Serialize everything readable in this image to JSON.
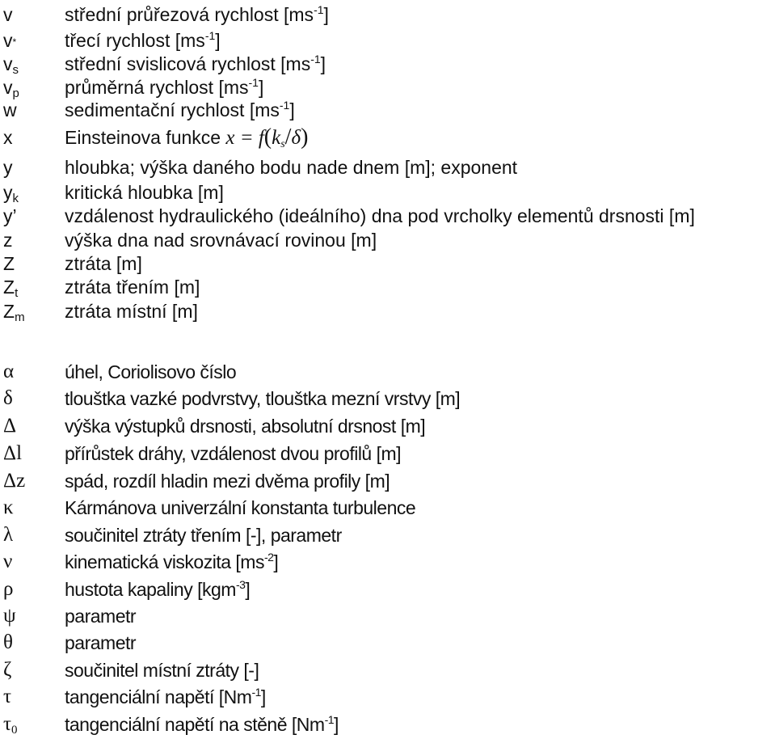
{
  "latin_symbols": [
    {
      "sym": "v",
      "sub": "",
      "desc": "střední průřezová rychlost [ms",
      "sup": "-1",
      "tail": "]"
    },
    {
      "sym": "v",
      "sub": "*",
      "desc": "třecí rychlost [ms",
      "sup": "-1",
      "tail": "]"
    },
    {
      "sym": "v",
      "sub": "s",
      "desc": "střední svislicová rychlost [ms",
      "sup": "-1",
      "tail": "]"
    },
    {
      "sym": "v",
      "sub": "p",
      "desc": "průměrná rychlost [ms",
      "sup": "-1",
      "tail": "]"
    },
    {
      "sym": "w",
      "sub": "",
      "desc": "sedimentační rychlost [ms",
      "sup": "-1",
      "tail": "]"
    },
    {
      "sym": "x",
      "sub": "",
      "desc": "Einsteinova funkce",
      "sup": "",
      "tail": ""
    },
    {
      "sym": "y",
      "sub": "",
      "desc": "hloubka; výška daného bodu nade dnem [m]; exponent",
      "sup": "",
      "tail": ""
    },
    {
      "sym": "y",
      "sub": "k",
      "desc": "kritická hloubka [m]",
      "sup": "",
      "tail": ""
    },
    {
      "sym": "y’",
      "sub": "",
      "desc": "vzdálenost hydraulického (ideálního) dna pod vrcholky elementů drsnosti [m]",
      "sup": "",
      "tail": ""
    },
    {
      "sym": "z",
      "sub": "",
      "desc": "výška dna nad srovnávací rovinou [m]",
      "sup": "",
      "tail": ""
    },
    {
      "sym": "Z",
      "sub": "",
      "desc": "ztráta [m]",
      "sup": "",
      "tail": ""
    },
    {
      "sym": "Z",
      "sub": "t",
      "desc": "ztráta třením [m]",
      "sup": "",
      "tail": ""
    },
    {
      "sym": "Z",
      "sub": "m",
      "desc": "ztráta místní [m]",
      "sup": "",
      "tail": ""
    }
  ],
  "einstein_formula": {
    "lhs": "x",
    "eq": " = ",
    "f": "f",
    "open": "(",
    "k": "k",
    "ksub": "s",
    "slash": "/",
    "delta": "δ",
    "close": ")"
  },
  "greek_symbols": [
    {
      "sym": "α",
      "sub": "",
      "desc": "úhel,  Coriolisovo číslo",
      "sup": "",
      "tail": ""
    },
    {
      "sym": "δ",
      "sub": "",
      "desc": "tlouštka vazké podvrstvy, tlouštka mezní vrstvy  [m]",
      "sup": "",
      "tail": ""
    },
    {
      "sym": "Δ",
      "sub": "",
      "desc": "výška výstupků drsnosti, absolutní drsnost  [m]",
      "sup": "",
      "tail": ""
    },
    {
      "sym": "Δl",
      "sub": "",
      "desc": "přírůstek dráhy, vzdálenost dvou profilů [m]",
      "sup": "",
      "tail": ""
    },
    {
      "sym": "Δz",
      "sub": "",
      "desc": "spád, rozdíl hladin mezi dvěma profily [m]",
      "sup": "",
      "tail": ""
    },
    {
      "sym": "κ",
      "sub": "",
      "desc": "Kármánova univerzální konstanta turbulence",
      "sup": "",
      "tail": ""
    },
    {
      "sym": "λ",
      "sub": "",
      "desc": "součinitel ztráty třením [-], parametr",
      "sup": "",
      "tail": ""
    },
    {
      "sym": "ν",
      "sub": "",
      "desc": "kinematická viskozita [ms",
      "sup": "-2",
      "tail": "]"
    },
    {
      "sym": "ρ",
      "sub": "",
      "desc": "hustota kapaliny [kgm",
      "sup": "-3",
      "tail": "]"
    },
    {
      "sym": "ψ",
      "sub": "",
      "desc": "parametr",
      "sup": "",
      "tail": ""
    },
    {
      "sym": "θ",
      "sub": "",
      "desc": "parametr",
      "sup": "",
      "tail": ""
    },
    {
      "sym": "ζ",
      "sub": "",
      "desc": "součinitel místní ztráty [-]",
      "sup": "",
      "tail": ""
    },
    {
      "sym": "τ",
      "sub": "",
      "desc": "tangenciální napětí [Nm",
      "sup": "-1",
      "tail": "]"
    },
    {
      "sym": "τ",
      "sub": "0",
      "desc": "tangenciální napětí na stěně [Nm",
      "sup": "-1",
      "tail": "]"
    }
  ]
}
